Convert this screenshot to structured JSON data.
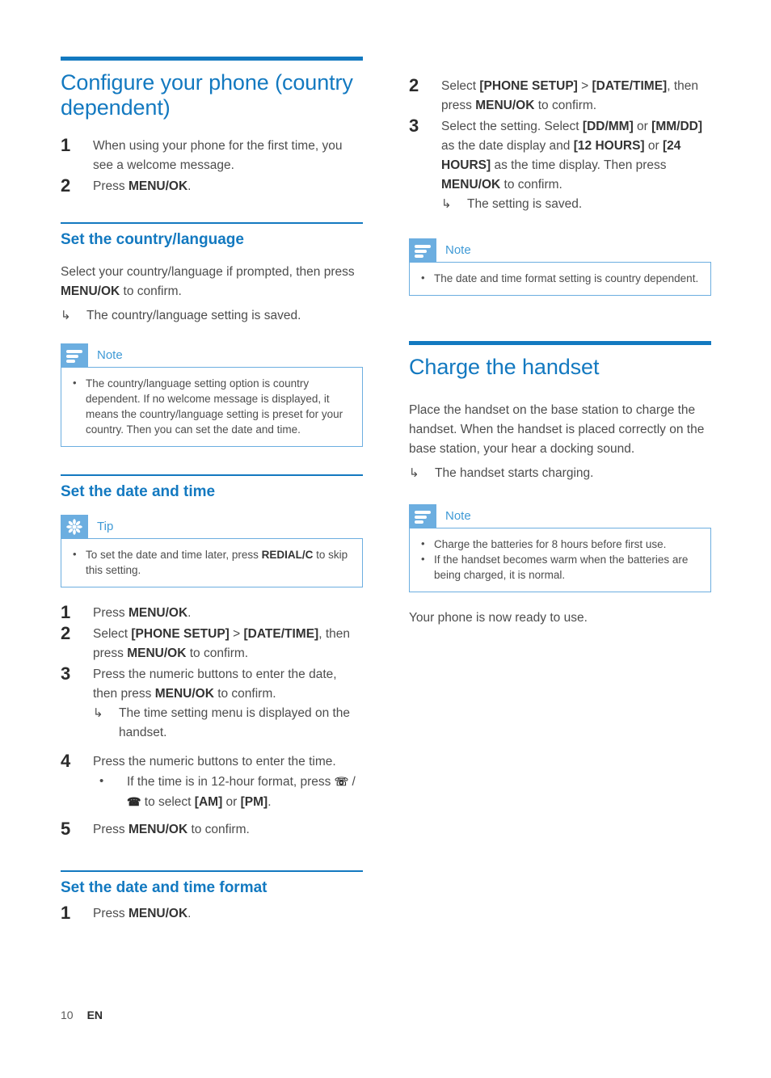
{
  "page": {
    "footer_page_number": "10",
    "footer_language": "EN",
    "accent_blue": "#1379c0",
    "callout_blue": "#6caee0",
    "body_gray": "#4d4d4d"
  },
  "left_column": {
    "chapter_title": "Configure your phone (country dependent)",
    "intro_steps": [
      {
        "num": "1",
        "text_parts": [
          {
            "t": "When using your phone for the first time, you see a welcome message.",
            "b": false
          }
        ]
      },
      {
        "num": "2",
        "text_parts": [
          {
            "t": "Press ",
            "b": false
          },
          {
            "t": "MENU/OK",
            "b": true
          },
          {
            "t": ".",
            "b": false
          }
        ]
      }
    ],
    "section_country": {
      "heading": "Set the country/language",
      "paragraph_parts": [
        {
          "t": "Select your country/language if prompted, then press ",
          "b": false
        },
        {
          "t": "MENU/OK",
          "b": true
        },
        {
          "t": " to confirm.",
          "b": false
        }
      ],
      "result": "The country/language setting is saved.",
      "note": {
        "label": "Note",
        "icon": "note-lines-icon",
        "bullets": [
          "The country/language setting option is country dependent. If no welcome message is displayed, it means the country/language setting is preset for your country. Then you can set the date and time."
        ]
      }
    },
    "section_datetime": {
      "heading": "Set the date and time",
      "tip": {
        "label": "Tip",
        "icon": "tip-asterisk-icon",
        "bullets_parts": [
          [
            {
              "t": "To set the date and time later, press ",
              "b": false
            },
            {
              "t": "REDIAL/C",
              "b": true
            },
            {
              "t": " to skip this setting.",
              "b": false
            }
          ]
        ]
      },
      "steps": [
        {
          "num": "1",
          "parts": [
            {
              "t": "Press ",
              "b": false
            },
            {
              "t": "MENU/OK",
              "b": true
            },
            {
              "t": ".",
              "b": false
            }
          ]
        },
        {
          "num": "2",
          "parts": [
            {
              "t": "Select ",
              "b": false
            },
            {
              "t": "[PHONE SETUP]",
              "b": true
            },
            {
              "t": " > ",
              "b": false
            },
            {
              "t": "[DATE/TIME]",
              "b": true
            },
            {
              "t": ", then press ",
              "b": false
            },
            {
              "t": "MENU/OK",
              "b": true
            },
            {
              "t": " to confirm.",
              "b": false
            }
          ]
        },
        {
          "num": "3",
          "parts": [
            {
              "t": "Press the numeric buttons to enter the date, then press ",
              "b": false
            },
            {
              "t": "MENU/OK",
              "b": true
            },
            {
              "t": " to confirm.",
              "b": false
            }
          ],
          "result": "The time setting menu is displayed on the handset."
        },
        {
          "num": "4",
          "parts": [
            {
              "t": "Press the numeric buttons to enter the time.",
              "b": false
            }
          ],
          "subbullet_parts": [
            {
              "t": "If the time is in 12-hour format, press ",
              "b": false
            },
            {
              "t": "GLYPH_UP",
              "b": false
            },
            {
              "t": " / ",
              "b": false
            },
            {
              "t": "GLYPH_DOWN",
              "b": false
            },
            {
              "t": " to select ",
              "b": false
            },
            {
              "t": "[AM]",
              "b": true
            },
            {
              "t": " or ",
              "b": false
            },
            {
              "t": "[PM]",
              "b": true
            },
            {
              "t": ".",
              "b": false
            }
          ]
        },
        {
          "num": "5",
          "parts": [
            {
              "t": "Press ",
              "b": false
            },
            {
              "t": "MENU/OK",
              "b": true
            },
            {
              "t": " to confirm.",
              "b": false
            }
          ]
        }
      ]
    },
    "section_format": {
      "heading": "Set the date and time format",
      "steps": [
        {
          "num": "1",
          "parts": [
            {
              "t": "Press ",
              "b": false
            },
            {
              "t": "MENU/OK",
              "b": true
            },
            {
              "t": ".",
              "b": false
            }
          ]
        }
      ]
    }
  },
  "right_column": {
    "format_steps": [
      {
        "num": "2",
        "parts": [
          {
            "t": "Select ",
            "b": false
          },
          {
            "t": "[PHONE SETUP]",
            "b": true
          },
          {
            "t": " > ",
            "b": false
          },
          {
            "t": "[DATE/TIME]",
            "b": true
          },
          {
            "t": ", then press ",
            "b": false
          },
          {
            "t": "MENU/OK",
            "b": true
          },
          {
            "t": " to confirm.",
            "b": false
          }
        ]
      },
      {
        "num": "3",
        "parts": [
          {
            "t": "Select the setting. Select ",
            "b": false
          },
          {
            "t": "[DD/MM]",
            "b": true
          },
          {
            "t": " or ",
            "b": false
          },
          {
            "t": "[MM/DD]",
            "b": true
          },
          {
            "t": " as the date display and ",
            "b": false
          },
          {
            "t": "[12 HOURS]",
            "b": true
          },
          {
            "t": " or ",
            "b": false
          },
          {
            "t": "[24 HOURS]",
            "b": true
          },
          {
            "t": " as the time display. Then press ",
            "b": false
          },
          {
            "t": "MENU/OK",
            "b": true
          },
          {
            "t": " to confirm.",
            "b": false
          }
        ],
        "result": "The setting is saved."
      }
    ],
    "format_note": {
      "label": "Note",
      "icon": "note-lines-icon",
      "bullets": [
        "The date and time format setting is country dependent."
      ]
    },
    "chapter_charge": {
      "title": "Charge the handset",
      "paragraph": "Place the handset on the base station to charge the handset. When the handset is placed correctly on the base station, your hear a docking sound.",
      "result": "The handset starts charging.",
      "note": {
        "label": "Note",
        "icon": "note-lines-icon",
        "bullets": [
          "Charge the batteries for 8 hours before first use.",
          "If the handset becomes warm when the batteries are being charged, it is normal."
        ]
      },
      "closing": "Your phone is now ready to use."
    }
  }
}
